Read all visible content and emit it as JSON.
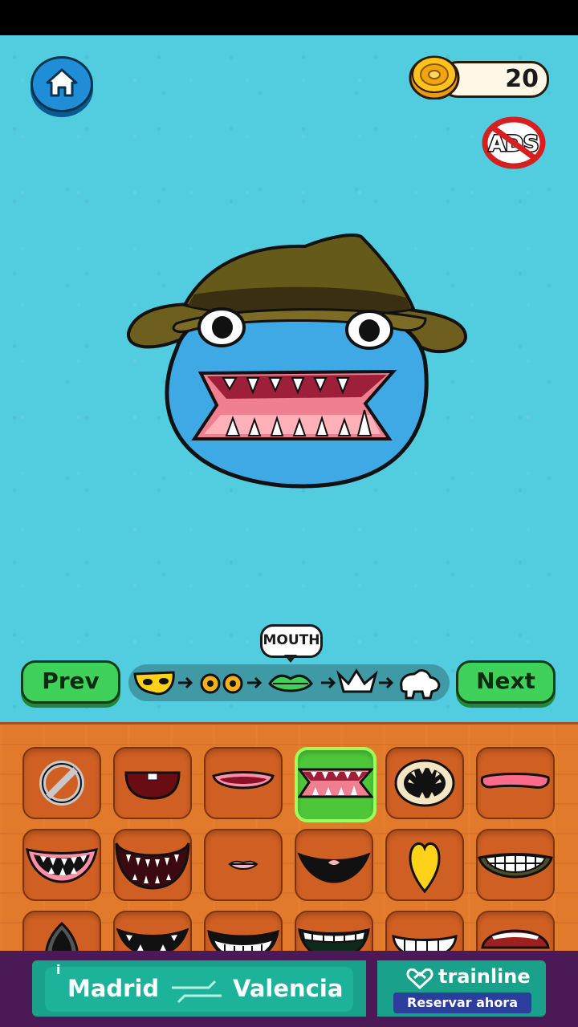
{
  "header": {
    "home_icon": "home-icon",
    "coin_count": "20",
    "no_ads_label": "ADS"
  },
  "editor": {
    "tooltip": "MOUTH",
    "prev_label": "Prev",
    "next_label": "Next",
    "steps": [
      {
        "name": "mask",
        "icon": "mask-step-icon"
      },
      {
        "name": "eyes",
        "icon": "eyes-step-icon"
      },
      {
        "name": "mouth",
        "icon": "mouth-step-icon",
        "current": true
      },
      {
        "name": "hat",
        "icon": "crown-step-icon"
      },
      {
        "name": "hands",
        "icon": "hand-step-icon"
      }
    ],
    "selected_part": "sharp-teeth-mouth"
  },
  "parts_grid": {
    "rows": [
      [
        "none",
        "gap-tooth-mouth",
        "pink-lips-mouth",
        "sharp-teeth-mouth",
        "round-teeth-mouth",
        "tongue-mouth"
      ],
      [
        "grin-fangs-mouth",
        "dark-fangs-mouth",
        "small-lips-mouth",
        "black-smile-mouth",
        "yellow-heart-mouth",
        "grin-teeth-mouth"
      ],
      [
        "spike-mouth",
        "wide-smile-mouth",
        "big-teeth-mouth",
        "green-teeth-mouth",
        "white-teeth-mouth",
        "open-red-mouth"
      ]
    ]
  },
  "ad": {
    "from": "Madrid",
    "to": "Valencia",
    "brand": "trainline",
    "cta": "Reservar ahora",
    "info": "i"
  },
  "colors": {
    "sky": "#52cde0",
    "panel": "#e27a2c",
    "selected_slot": "#4ec63a",
    "button_green": "#3fd15a"
  }
}
